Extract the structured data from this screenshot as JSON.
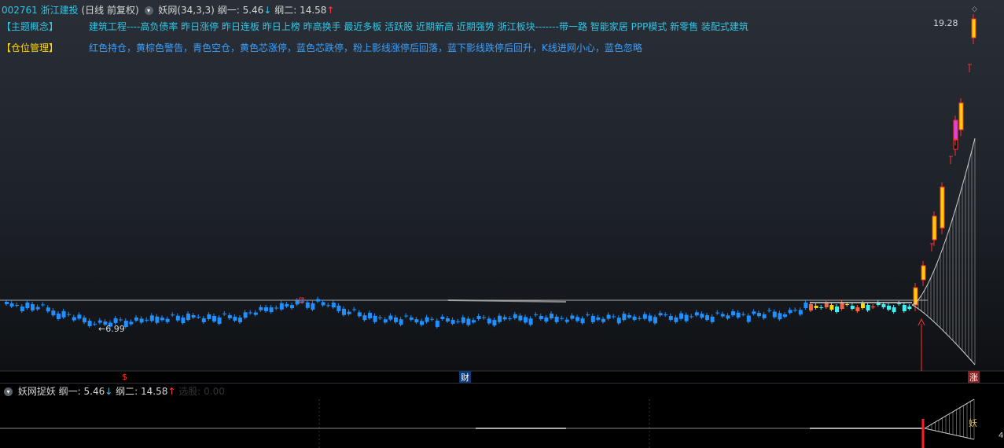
{
  "header": {
    "code": "002761",
    "name": "浙江建投",
    "mode": "(日线 前复权)",
    "indicator": "妖网(34,3,3)",
    "line1_label": "纲一:",
    "line1_value": "5.46",
    "line2_label": "纲二:",
    "line2_value": "14.58"
  },
  "concept": {
    "label": "【主题概念】",
    "text": "建筑工程----高负债率 昨日涨停 昨日连板 昨日上榜 昨高换手 最近多板 活跃股 近期新高 近期强势 浙江板块-------带一路 智能家居 PPP模式 新零售 装配式建筑"
  },
  "position": {
    "label": "【仓位管理】",
    "text": "红色持仓，黄棕色警告，青色空仓，黄色芯涨停，蓝色芯跌停，粉上影线涨停后回落，蓝下影线跌停后回升，K线进网小心，蓝色忽略"
  },
  "price_labels": {
    "high": "19.28",
    "low": "6.99",
    "low_arrow": "←"
  },
  "markers": {
    "dollar": "$",
    "cai": "财",
    "zhang": "涨",
    "yao": "妖"
  },
  "sub": {
    "title": "妖网捉妖",
    "line1_label": "纲一:",
    "line1_value": "5.46",
    "line2_label": "纲二:",
    "line2_value": "14.58",
    "extra": "选股: 0.00",
    "axis_value": "4"
  },
  "colors": {
    "up_candle": "#ffd700",
    "down_candle": "#1e90ff",
    "warn_candle": "#ff2020",
    "pink_candle": "#e040e0",
    "cyan_candle": "#3ff0f0",
    "net_line": "#d0d0d0"
  },
  "icons": {
    "header_circle": "circle-chevron-icon",
    "sub_circle": "circle-chevron-icon",
    "corner_diamond": "diamond-icon"
  }
}
